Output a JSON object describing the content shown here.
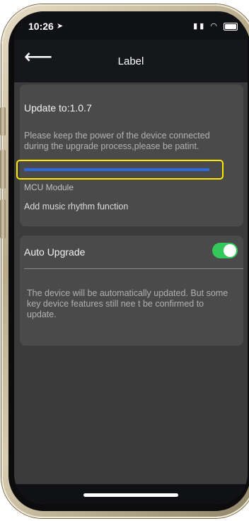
{
  "status_bar": {
    "time": "10:26",
    "location_glyph": "➤",
    "signal_glyph": "▮▮",
    "wifi_glyph": "◠"
  },
  "navbar": {
    "back_glyph": "⟵",
    "title": "Label"
  },
  "update": {
    "title": "Update to:1.0.7",
    "description": "Please keep the power of the device connected during the upgrade process,please be patint.",
    "progress_fraction": 1.0,
    "progress_color": "#2b6ae0",
    "module": "MCU Module",
    "feature": "Add music rhythm function"
  },
  "auto_upgrade": {
    "label": "Auto Upgrade",
    "enabled": true,
    "toggle_color": "#34c759",
    "description": "The device will be automatically updated. But some key device features still nee t be confirmed to update."
  },
  "colors": {
    "highlight": "#ffea00",
    "background": "#3b3b3b",
    "card": "#4a4a4a"
  }
}
